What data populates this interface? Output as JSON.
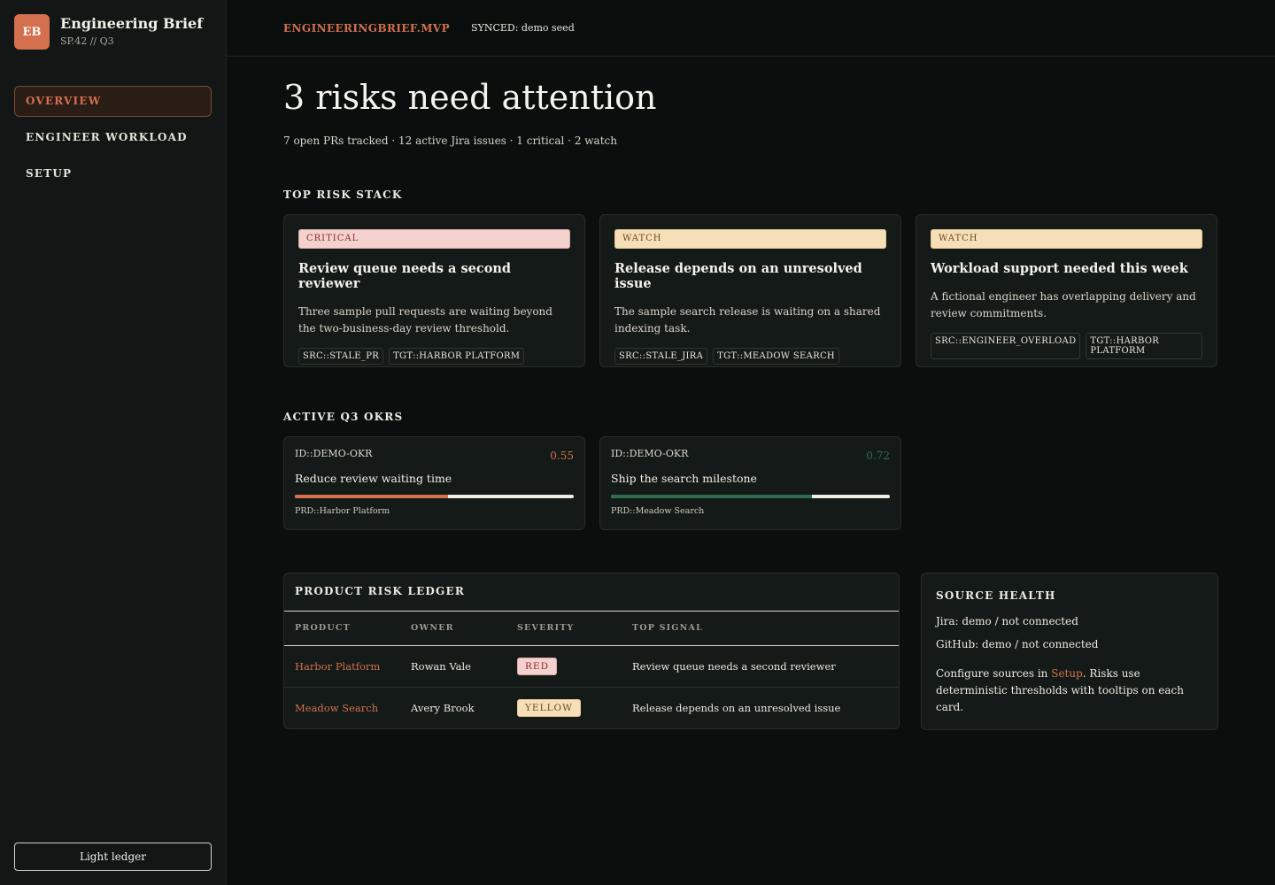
{
  "brand": {
    "initials": "EB",
    "title": "Engineering Brief",
    "subtitle": "SP.42 // Q3"
  },
  "nav": {
    "items": [
      {
        "label": "OVERVIEW",
        "active": true
      },
      {
        "label": "ENGINEER WORKLOAD",
        "active": false
      },
      {
        "label": "SETUP",
        "active": false
      }
    ]
  },
  "theme_toggle": "Light ledger",
  "topbar": {
    "app_id": "ENGINEERINGBRIEF.MVP",
    "sync_status": "SYNCED: demo seed"
  },
  "header": {
    "headline": "3 risks need attention",
    "summary": "7 open PRs tracked · 12 active Jira issues · 1 critical · 2 watch"
  },
  "risk_stack": {
    "label": "TOP RISK STACK",
    "cards": [
      {
        "badge": "CRITICAL",
        "title": "Review queue needs a second reviewer",
        "description": "Three sample pull requests are waiting beyond the two-business-day review threshold.",
        "tags": [
          "SRC::STALE_PR",
          "TGT::HARBOR PLATFORM"
        ]
      },
      {
        "badge": "WATCH",
        "title": "Release depends on an unresolved issue",
        "description": "The sample search release is waiting on a shared indexing task.",
        "tags": [
          "SRC::STALE_JIRA",
          "TGT::MEADOW SEARCH"
        ]
      },
      {
        "badge": "WATCH",
        "title": "Workload support needed this week",
        "description": "A fictional engineer has overlapping delivery and review commitments.",
        "tags": [
          "SRC::ENGINEER_OVERLOAD",
          "TGT::HARBOR PLATFORM"
        ]
      }
    ]
  },
  "okrs": {
    "label": "ACTIVE Q3 OKRS",
    "items": [
      {
        "id": "ID::DEMO-OKR",
        "score": "0.55",
        "progress": 0.55,
        "title": "Reduce review waiting time",
        "product": "PRD::Harbor Platform",
        "color": "#d4704d"
      },
      {
        "id": "ID::DEMO-OKR",
        "score": "0.72",
        "progress": 0.72,
        "title": "Ship the search milestone",
        "product": "PRD::Meadow Search",
        "color": "#2e6b4f"
      }
    ]
  },
  "ledger": {
    "title": "PRODUCT RISK LEDGER",
    "columns": [
      "PRODUCT",
      "OWNER",
      "SEVERITY",
      "TOP SIGNAL"
    ],
    "rows": [
      {
        "product": "Harbor Platform",
        "owner": "Rowan Vale",
        "severity": "RED",
        "signal": "Review queue needs a second reviewer"
      },
      {
        "product": "Meadow Search",
        "owner": "Avery Brook",
        "severity": "YELLOW",
        "signal": "Release depends on an unresolved issue"
      }
    ]
  },
  "source_health": {
    "title": "SOURCE HEALTH",
    "jira": "Jira: demo / not connected",
    "github": "GitHub: demo / not connected",
    "note_prefix": "Configure sources in ",
    "note_link": "Setup",
    "note_suffix": ". Risks use deterministic thresholds with tooltips on each card."
  },
  "colors": {
    "accent": "#d4704d",
    "success": "#2e6b4f"
  }
}
